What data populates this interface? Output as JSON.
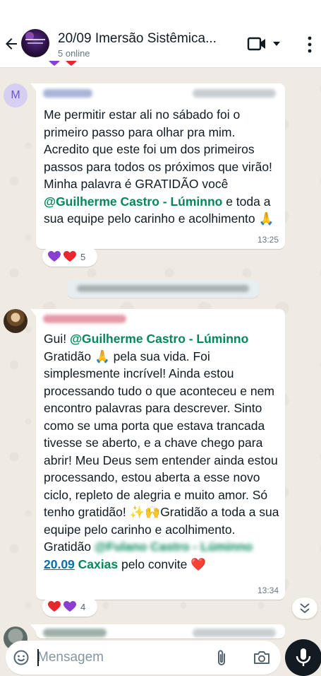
{
  "header": {
    "title": "20/09 Imersão Sistêmica...",
    "subtitle": "5 online",
    "back_icon": "back-arrow-icon",
    "video_icon": "video-call-icon",
    "menu_icon": "more-vert-icon"
  },
  "top_reaction_count": "",
  "messages": [
    {
      "avatar_initial": "M",
      "parts": [
        {
          "t": "Me permitir estar ali no sábado foi o primeiro passo para olhar pra mim. Acredito que este foi um dos primeiros passos para todos os próximos que virão! Minha palavra é GRATIDÃO  você ",
          "s": "text"
        },
        {
          "t": "@Guilherme Castro - Lúminno",
          "s": "mention"
        },
        {
          "t": " e toda a sua equipe pelo carinho e acolhimento 🙏",
          "s": "text"
        }
      ],
      "time": "13:25",
      "reaction_count": "5"
    },
    {
      "parts": [
        {
          "t": "Gui! ",
          "s": "text"
        },
        {
          "t": "@Guilherme Castro - Lúminno",
          "s": "mention"
        },
        {
          "t": " Gratidão 🙏 pela sua vida. Foi simplesmente incrível! Ainda estou processando tudo o que aconteceu e nem encontro palavras para descrever. Sinto como se uma porta que estava trancada tivesse se aberto, e a chave chego para abrir! Meu Deus sem entender ainda estou processando, estou aberta a esse novo ciclo, repleto de alegria e muito amor. Só tenho gratidão! ✨🙌Gratidão a toda a sua equipe pelo carinho e acolhimento. Gratidão ",
          "s": "text"
        },
        {
          "t": "@Fulano Castro - Lúminno",
          "s": "blur"
        },
        {
          "t": " ",
          "s": "text"
        },
        {
          "t": "20.09",
          "s": "link"
        },
        {
          "t": " ",
          "s": "text"
        },
        {
          "t": "Caxias",
          "s": "green"
        },
        {
          "t": " pelo convite ❤️",
          "s": "text"
        }
      ],
      "time": "13:34",
      "reaction_count": "4"
    }
  ],
  "input": {
    "placeholder": "Mensagem",
    "emoji_icon": "emoji-icon",
    "attach_icon": "paperclip-icon",
    "camera_icon": "camera-icon",
    "mic_icon": "microphone-icon"
  },
  "colors": {
    "mention": "#00875a",
    "link": "#0a6ea8",
    "background": "#efeae2",
    "bubble": "#ffffff",
    "heart_red": "#e8262d",
    "heart_purple": "#8a3fd1"
  }
}
